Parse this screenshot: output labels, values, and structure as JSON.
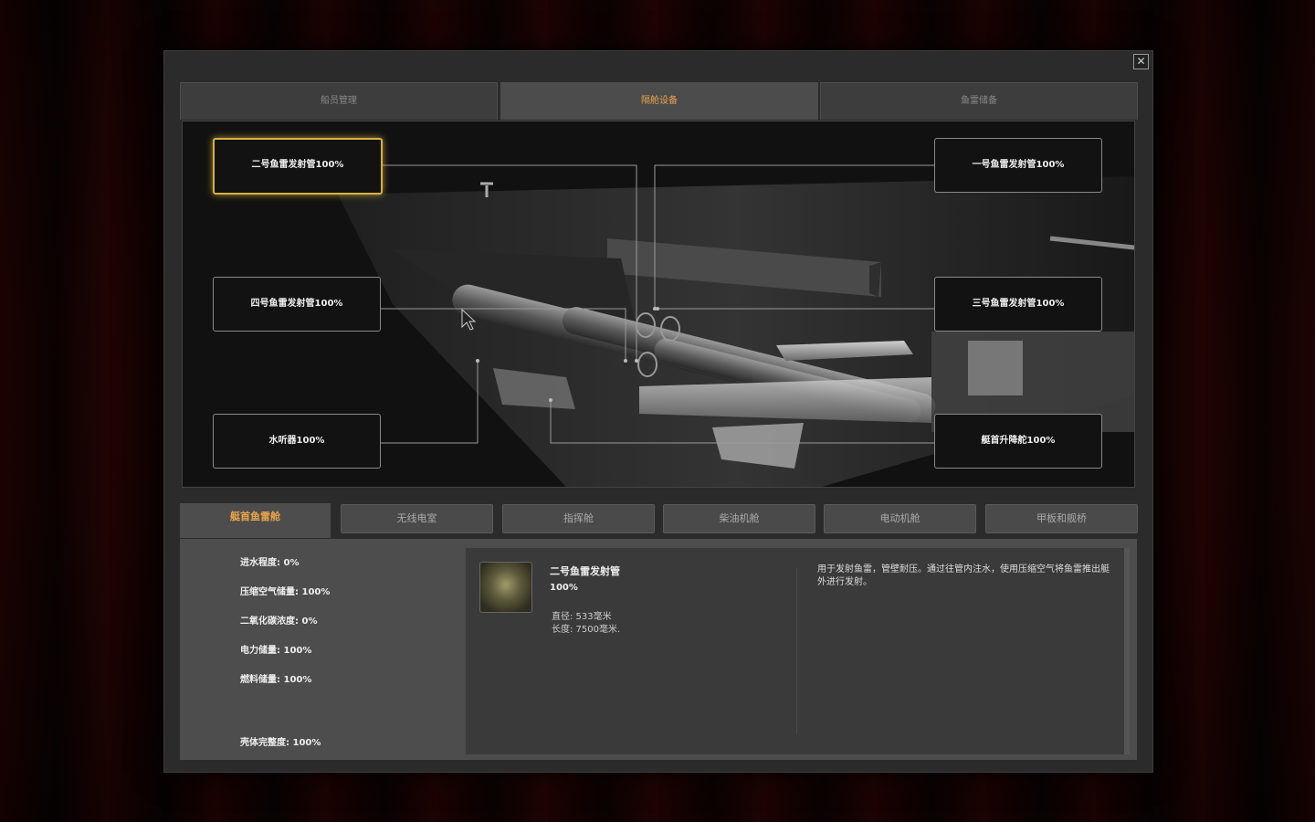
{
  "window": {
    "close_label": "✕"
  },
  "top_tabs": [
    {
      "label": "船员管理",
      "active": false
    },
    {
      "label": "隔舱设备",
      "active": true
    },
    {
      "label": "鱼雷储备",
      "active": false
    }
  ],
  "components": {
    "tube2": "二号鱼雷发射管100%",
    "tube1": "一号鱼雷发射管100%",
    "tube4": "四号鱼雷发射管100%",
    "tube3": "三号鱼雷发射管100%",
    "hydrophone": "水听器100%",
    "bow_planes": "艇首升降舵100%"
  },
  "bottom_tabs": [
    {
      "label": "艇首鱼雷舱",
      "active": true
    },
    {
      "label": "无线电室",
      "active": false
    },
    {
      "label": "指挥舱",
      "active": false
    },
    {
      "label": "柴油机舱",
      "active": false
    },
    {
      "label": "电动机舱",
      "active": false
    },
    {
      "label": "甲板和舰桥",
      "active": false
    }
  ],
  "stats": {
    "flooding": "进水程度: 0%",
    "compressed_air": "压缩空气储量: 100%",
    "co2": "二氧化碳浓度: 0%",
    "battery": "电力储量: 100%",
    "fuel": "燃料储量: 100%",
    "hull": "壳体完整度: 100%"
  },
  "selected_item": {
    "name": "二号鱼雷发射管",
    "condition": "100%",
    "diameter": "直径: 533毫米",
    "length": "长度: 7500毫米.",
    "description": "用于发射鱼雷，管壁耐压。通过往管内注水，使用压缩空气将鱼雷推出艇外进行发射。"
  },
  "colors": {
    "accent": "#e8a54a",
    "selected_border": "#d8b040"
  }
}
